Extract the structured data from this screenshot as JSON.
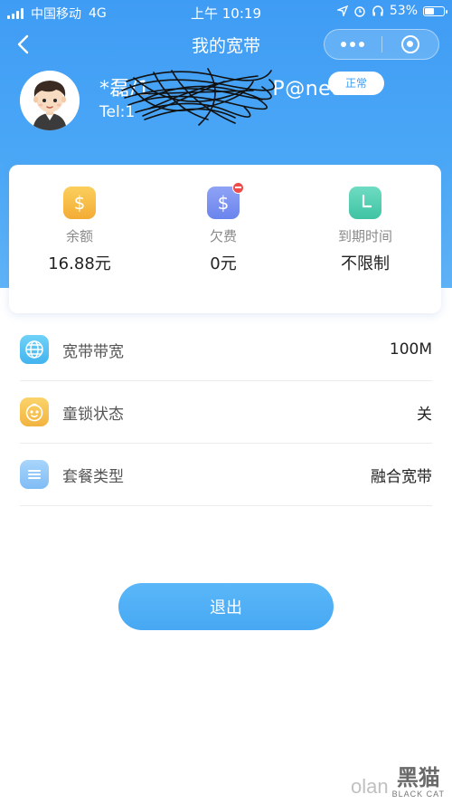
{
  "status_bar": {
    "carrier": "中国移动",
    "network": "4G",
    "time": "上午 10:19",
    "battery": "53%",
    "battery_level": 0.53
  },
  "nav": {
    "title": "我的宽带",
    "back_icon": "chevron-left-icon",
    "more_icon": "more-dots-icon",
    "close_icon": "target-close-icon"
  },
  "profile": {
    "username_visible_prefix": "*磊/1",
    "username_visible_suffix": "P@net",
    "tel_prefix": "Tel:1",
    "status": "正常"
  },
  "stats": [
    {
      "label": "余额",
      "value": "16.88元",
      "icon": "yuan-icon"
    },
    {
      "label": "欠费",
      "value": "0元",
      "icon": "debt-icon"
    },
    {
      "label": "到期时间",
      "value": "不限制",
      "icon": "clock-icon"
    }
  ],
  "details": [
    {
      "label": "宽带带宽",
      "value": "100M",
      "icon": "globe-icon"
    },
    {
      "label": "童锁状态",
      "value": "关",
      "icon": "child-face-icon"
    },
    {
      "label": "套餐类型",
      "value": "融合宽带",
      "icon": "list-icon"
    }
  ],
  "logout_label": "退出",
  "watermark": {
    "url": "olan",
    "brand": "黑猫",
    "brand_sub": "BLACK CAT"
  },
  "colors": {
    "primary": "#3f9cf4",
    "balance_icon": "#f3ac35",
    "debt_icon": "#6a84ee",
    "expire_icon": "#3ec3a3",
    "badge_dot": "#f04b4b"
  }
}
